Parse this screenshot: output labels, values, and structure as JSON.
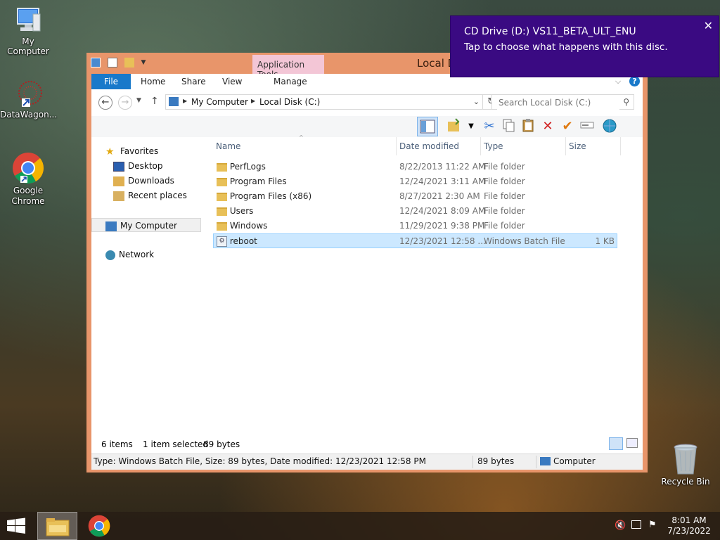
{
  "desktop": {
    "icons": [
      {
        "label": "My Computer"
      },
      {
        "label": "DataWagon..."
      },
      {
        "label": "Google Chrome"
      },
      {
        "label": "Recycle Bin"
      }
    ]
  },
  "window": {
    "title": "Local D",
    "context_tab": "Application Tools",
    "ribbon_tabs": [
      "File",
      "Home",
      "Share",
      "View",
      "Manage"
    ],
    "help": "?",
    "address": {
      "crumbs": [
        "My Computer",
        "Local Disk (C:)"
      ]
    },
    "search": {
      "placeholder": "Search Local Disk (C:)"
    },
    "nav": {
      "favorites": "Favorites",
      "desktop": "Desktop",
      "downloads": "Downloads",
      "recent": "Recent places",
      "mycomputer": "My Computer",
      "network": "Network"
    },
    "columns": {
      "name": "Name",
      "date": "Date modified",
      "type": "Type",
      "size": "Size"
    },
    "files": [
      {
        "name": "PerfLogs",
        "date": "8/22/2013 11:22 AM",
        "type": "File folder",
        "size": ""
      },
      {
        "name": "Program Files",
        "date": "12/24/2021 3:11 AM",
        "type": "File folder",
        "size": ""
      },
      {
        "name": "Program Files (x86)",
        "date": "8/27/2021 2:30 AM",
        "type": "File folder",
        "size": ""
      },
      {
        "name": "Users",
        "date": "12/24/2021 8:09 AM",
        "type": "File folder",
        "size": ""
      },
      {
        "name": "Windows",
        "date": "11/29/2021 9:38 PM",
        "type": "File folder",
        "size": ""
      },
      {
        "name": "reboot",
        "date": "12/23/2021 12:58 ...",
        "type": "Windows Batch File",
        "size": "1 KB"
      }
    ],
    "status": {
      "items": "6 items",
      "selected": "1 item selected",
      "bytes": "89 bytes",
      "details": "Type: Windows Batch File, Size: 89 bytes, Date modified: 12/23/2021 12:58 PM",
      "size2": "89 bytes",
      "location": "Computer"
    }
  },
  "toast": {
    "title": "CD Drive (D:) VS11_BETA_ULT_ENU",
    "body": "Tap to choose what happens with this disc.",
    "close": "✕"
  },
  "taskbar": {
    "time": "8:01 AM",
    "date": "7/23/2022"
  }
}
